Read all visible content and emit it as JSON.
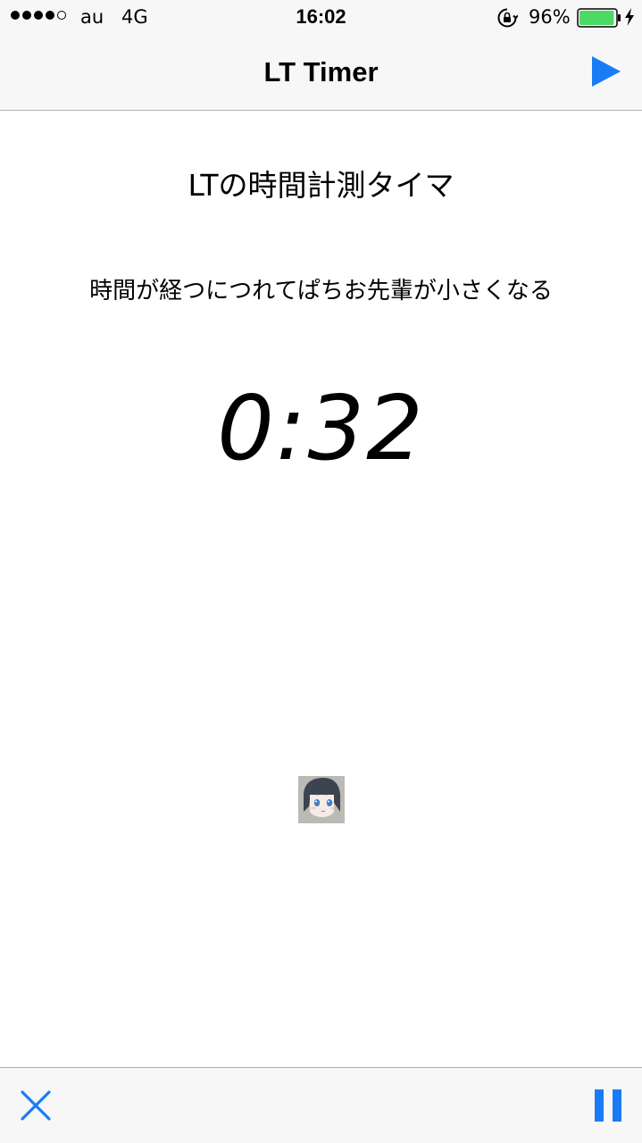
{
  "status_bar": {
    "signal_bars_filled": 4,
    "signal_bars_total": 5,
    "carrier": "au",
    "network": "4G",
    "time": "16:02",
    "battery_percent": "96%",
    "battery_level": 0.96,
    "battery_color": "#4cd964",
    "icons": [
      "orientation-lock-icon",
      "battery-icon",
      "charging-bolt-icon"
    ]
  },
  "nav_bar": {
    "title": "LT Timer",
    "right_button_icon": "play-icon"
  },
  "main": {
    "heading": "LTの時間計測タイマ",
    "description": "時間が経つにつれてぱちお先輩が小さくなる",
    "timer": "0:32",
    "avatar_icon": "character-avatar"
  },
  "toolbar": {
    "left_button_icon": "close-icon",
    "right_button_icon": "pause-icon"
  },
  "colors": {
    "accent": "#1a7cf5",
    "bar_background": "#f7f7f7",
    "separator": "#b2b2b2"
  }
}
